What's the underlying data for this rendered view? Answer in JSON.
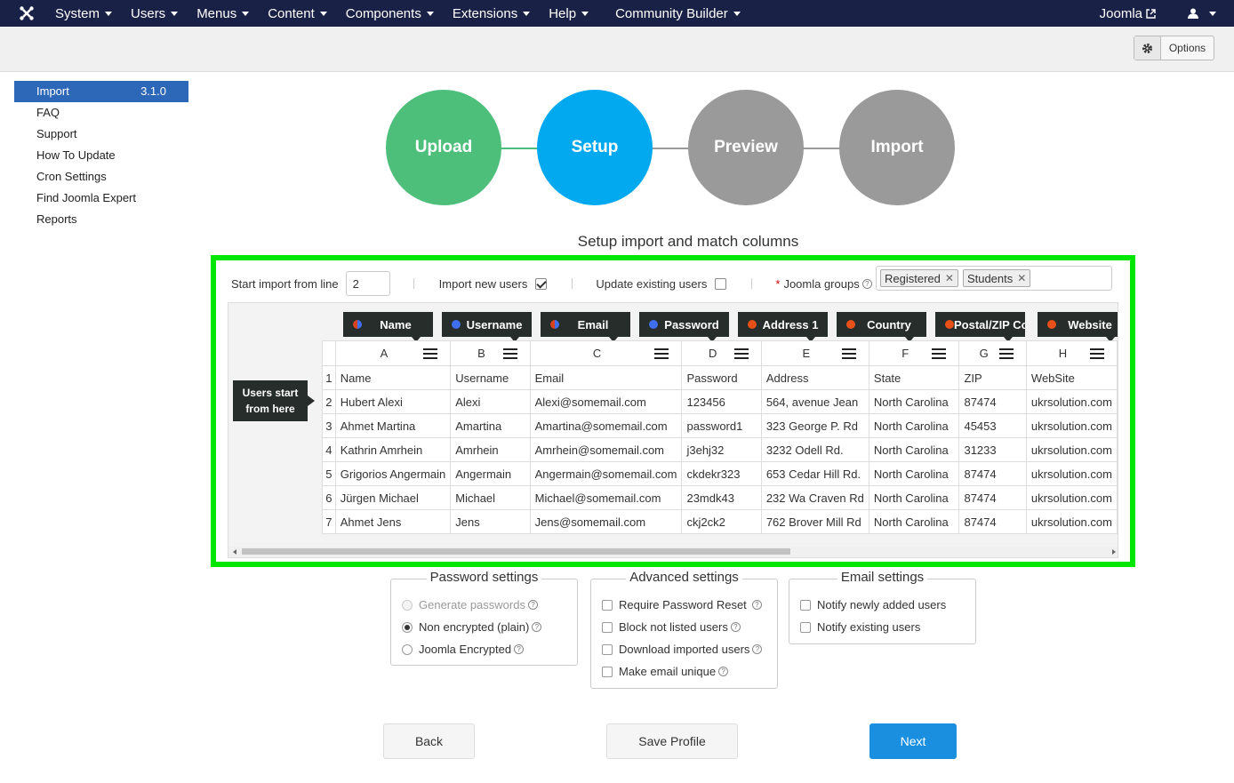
{
  "navbar": {
    "items": [
      "System",
      "Users",
      "Menus",
      "Content",
      "Components",
      "Extensions",
      "Help",
      "Community Builder"
    ],
    "site_link": "Joomla"
  },
  "toolbar": {
    "options_label": "Options"
  },
  "sidebar": {
    "items": [
      {
        "label": "Import",
        "version": "3.1.0",
        "active": true
      },
      {
        "label": "FAQ"
      },
      {
        "label": "Support"
      },
      {
        "label": "How To Update"
      },
      {
        "label": "Cron Settings"
      },
      {
        "label": "Find Joomla Expert"
      },
      {
        "label": "Reports"
      }
    ]
  },
  "wizard": {
    "steps": [
      "Upload",
      "Setup",
      "Preview",
      "Import"
    ],
    "current": 1
  },
  "section_title": "Setup import and match columns",
  "import_options": {
    "start_line_label": "Start import from line",
    "start_line_value": "2",
    "import_new_label": "Import new users",
    "import_new_checked": true,
    "update_existing_label": "Update existing users",
    "update_existing_checked": false,
    "groups_label": "Joomla groups",
    "groups": [
      "Registered",
      "Students"
    ]
  },
  "grid": {
    "mappers": [
      {
        "label": "Name",
        "dot": "mix"
      },
      {
        "label": "Username",
        "dot": "blue"
      },
      {
        "label": "Email",
        "dot": "mix"
      },
      {
        "label": "Password",
        "dot": "blue"
      },
      {
        "label": "Address 1",
        "dot": "orange"
      },
      {
        "label": "Country",
        "dot": "orange"
      },
      {
        "label": "Postal/ZIP Code",
        "dot": "orange"
      },
      {
        "label": "Website",
        "dot": "orange"
      }
    ],
    "columns": [
      "A",
      "B",
      "C",
      "D",
      "E",
      "F",
      "G",
      "H"
    ],
    "rows": [
      [
        "1",
        "Name",
        "Username",
        "Email",
        "Password",
        "Address",
        "State",
        "ZIP",
        "WebSite"
      ],
      [
        "2",
        "Hubert Alexi",
        "Alexi",
        "Alexi@somemail.com",
        "123456",
        "564, avenue Jean",
        "North Carolina",
        "87474",
        "ukrsolution.com"
      ],
      [
        "3",
        "Ahmet Martina",
        "Amartina",
        "Amartina@somemail.com",
        "password1",
        "323 George P. Rd",
        "North Carolina",
        "45453",
        "ukrsolution.com"
      ],
      [
        "4",
        "Kathrin Amrhein",
        "Amrhein",
        "Amrhein@somemail.com",
        "j3ehj32",
        "3232 Odell Rd.",
        "North Carolina",
        "31233",
        "ukrsolution.com"
      ],
      [
        "5",
        "Grigorios Angermain",
        "Angermain",
        "Angermain@somemail.com",
        "ckdekr323",
        "653 Cedar Hill Rd.",
        "North Carolina",
        "87474",
        "ukrsolution.com"
      ],
      [
        "6",
        "Jürgen Michael",
        "Michael",
        "Michael@somemail.com",
        "23mdk43",
        "232 Wa Craven Rd",
        "North Carolina",
        "87474",
        "ukrsolution.com"
      ],
      [
        "7",
        "Ahmet Jens",
        "Jens",
        "Jens@somemail.com",
        "ckj2ck2",
        "762 Brover Mill Rd",
        "North Carolina",
        "87474",
        "ukrsolution.com"
      ]
    ],
    "users_start_label": "Users start from here"
  },
  "password_settings": {
    "legend": "Password settings",
    "options": [
      {
        "label": "Generate passwords",
        "checked": false,
        "disabled": true
      },
      {
        "label": "Non encrypted (plain)",
        "checked": true,
        "disabled": false
      },
      {
        "label": "Joomla Encrypted",
        "checked": false,
        "disabled": false
      }
    ]
  },
  "advanced_settings": {
    "legend": "Advanced settings",
    "options": [
      "Require Password Reset",
      "Block not listed users",
      "Download imported users",
      "Make email unique"
    ]
  },
  "email_settings": {
    "legend": "Email settings",
    "options": [
      "Notify newly added users",
      "Notify existing users"
    ]
  },
  "buttons": {
    "back": "Back",
    "save_profile": "Save Profile",
    "next": "Next"
  }
}
